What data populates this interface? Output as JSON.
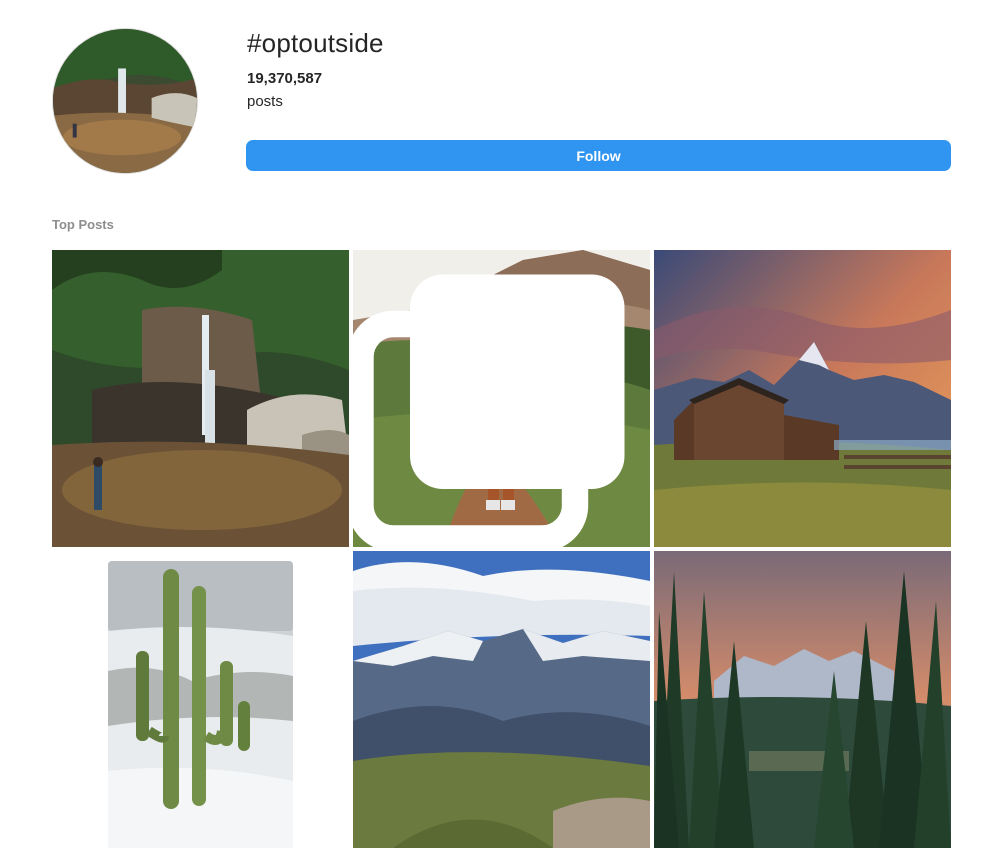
{
  "hashtag": {
    "title": "#optoutside",
    "post_count": "19,370,587",
    "post_unit": "posts",
    "follow_label": "Follow"
  },
  "top_posts": {
    "label": "Top Posts",
    "posts": [
      {
        "subject": "waterfall-pool-hiker",
        "multiple": false
      },
      {
        "subject": "backpacker-mountain-trail",
        "multiple": true
      },
      {
        "subject": "barn-mountains-sunset",
        "multiple": false
      },
      {
        "subject": "snowy-saguaro-cactus",
        "multiple": false
      },
      {
        "subject": "snowy-mountain-range",
        "multiple": false
      },
      {
        "subject": "pine-forest-sunset",
        "multiple": false
      }
    ]
  },
  "colors": {
    "follow_button": "#2f95f0",
    "section_label": "#8e8e8e",
    "text": "#262626"
  },
  "icons": {
    "multiple_posts": "carousel-icon"
  }
}
